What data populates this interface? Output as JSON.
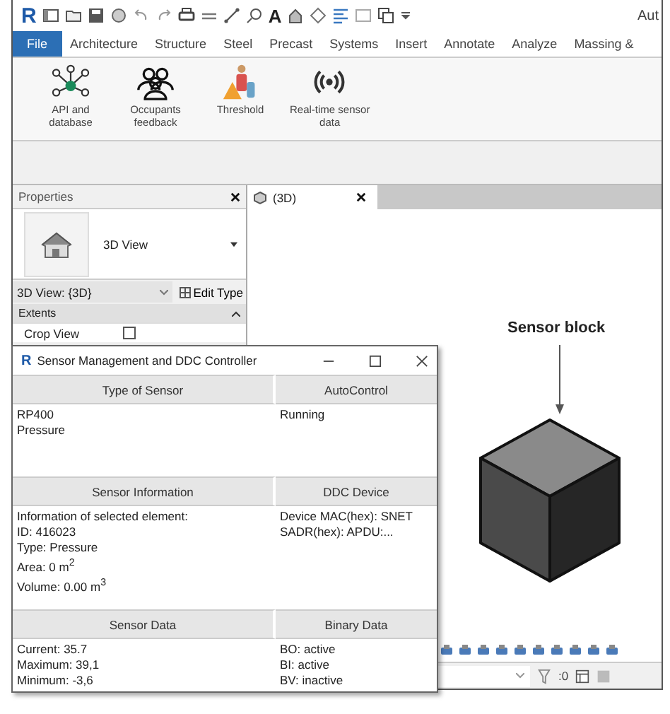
{
  "app": {
    "logo_letter": "R",
    "text_tool_glyph": "A",
    "title_fragment": "Aut"
  },
  "ribbon_tabs": [
    {
      "label": "File",
      "selected": true
    },
    {
      "label": "Architecture",
      "selected": false
    },
    {
      "label": "Structure",
      "selected": false
    },
    {
      "label": "Steel",
      "selected": false
    },
    {
      "label": "Precast",
      "selected": false
    },
    {
      "label": "Systems",
      "selected": false
    },
    {
      "label": "Insert",
      "selected": false
    },
    {
      "label": "Annotate",
      "selected": false
    },
    {
      "label": "Analyze",
      "selected": false
    },
    {
      "label": "Massing &",
      "selected": false
    }
  ],
  "ribbon_buttons": [
    {
      "kind": "network",
      "label": "API and\ndatabase"
    },
    {
      "kind": "people",
      "label": "Occupants\nfeedback"
    },
    {
      "kind": "threshold",
      "label": "Threshold"
    },
    {
      "kind": "signal",
      "label": "Real-time sensor\ndata"
    }
  ],
  "properties": {
    "title": "Properties",
    "type_name": "3D View",
    "view_selector": "3D View: {3D}",
    "edit_type": "Edit Type",
    "category": "Extents",
    "rows": [
      {
        "label": "Crop View",
        "checked": false
      }
    ]
  },
  "view": {
    "tab": "(3D)",
    "annotation": "Sensor block"
  },
  "status_bar": {
    "filter_count": ":0"
  },
  "dialog": {
    "icon_letter": "R",
    "title": "Sensor Management and DDC Controller",
    "sections": [
      {
        "left": {
          "header": "Type of Sensor",
          "lines": [
            "RP400",
            "Pressure"
          ]
        },
        "right": {
          "header": "AutoControl",
          "lines": [
            "Running"
          ]
        }
      },
      {
        "left": {
          "header": "Sensor Information",
          "lines": [
            "Information of selected element:",
            "ID: 416023",
            "Type: Pressure",
            "Area: 0 m$^{2}$",
            "Volume: 0.00 m$^{3}$"
          ]
        },
        "right": {
          "header": "DDC Device",
          "lines": [
            "Device MAC(hex): SNET",
            "SADR(hex): APDU:..."
          ]
        }
      },
      {
        "left": {
          "header": "Sensor Data",
          "lines": [
            "Current: 35.7",
            "Maximum: 39,1",
            "Minimum: -3,6"
          ]
        },
        "right": {
          "header": "Binary Data",
          "lines": [
            "BO: active",
            "BI: active",
            "BV: inactive"
          ]
        }
      }
    ]
  }
}
